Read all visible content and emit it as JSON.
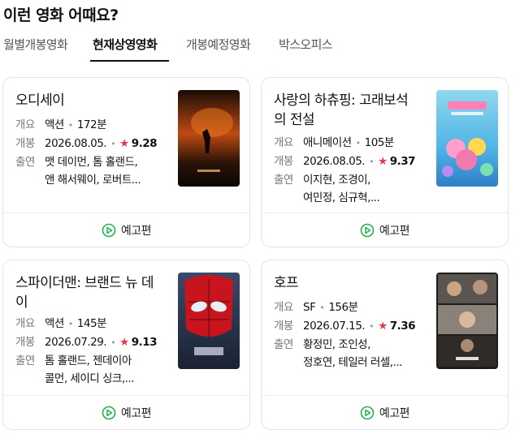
{
  "section_title": "이런 영화 어때요?",
  "tabs": [
    {
      "label": "월별개봉영화",
      "active": false
    },
    {
      "label": "현재상영영화",
      "active": true
    },
    {
      "label": "개봉예정영화",
      "active": false
    },
    {
      "label": "박스오피스",
      "active": false
    }
  ],
  "labels": {
    "genre": "개요",
    "release": "개봉",
    "cast": "출연",
    "trailer": "예고편"
  },
  "movies": [
    {
      "title": "오디세이",
      "genre": "액션",
      "runtime": "172분",
      "release_date": "2026.08.05.",
      "rating": "9.28",
      "cast_line1": "맷 데이먼, 톰 홀랜드,",
      "cast_line2": "앤 해서웨이, 로버트..."
    },
    {
      "title": "사랑의 하츄핑: 고래보석의 전설",
      "genre": "애니메이션",
      "runtime": "105분",
      "release_date": "2026.08.05.",
      "rating": "9.37",
      "cast_line1": "이지현, 조경이,",
      "cast_line2": "여민정, 심규혁,..."
    },
    {
      "title": "스파이더맨: 브랜드 뉴 데이",
      "genre": "액션",
      "runtime": "145분",
      "release_date": "2026.07.29.",
      "rating": "9.13",
      "cast_line1": "톰 홀랜드, 젠데이아",
      "cast_line2": "콜먼, 세이디 싱크,..."
    },
    {
      "title": "호프",
      "genre": "SF",
      "runtime": "156분",
      "release_date": "2026.07.15.",
      "rating": "7.36",
      "cast_line1": "황정민, 조인성,",
      "cast_line2": "정호연, 테일러 러셀,..."
    }
  ],
  "colors": {
    "star": "#e8384f",
    "trailer_icon": "#22b14c"
  }
}
